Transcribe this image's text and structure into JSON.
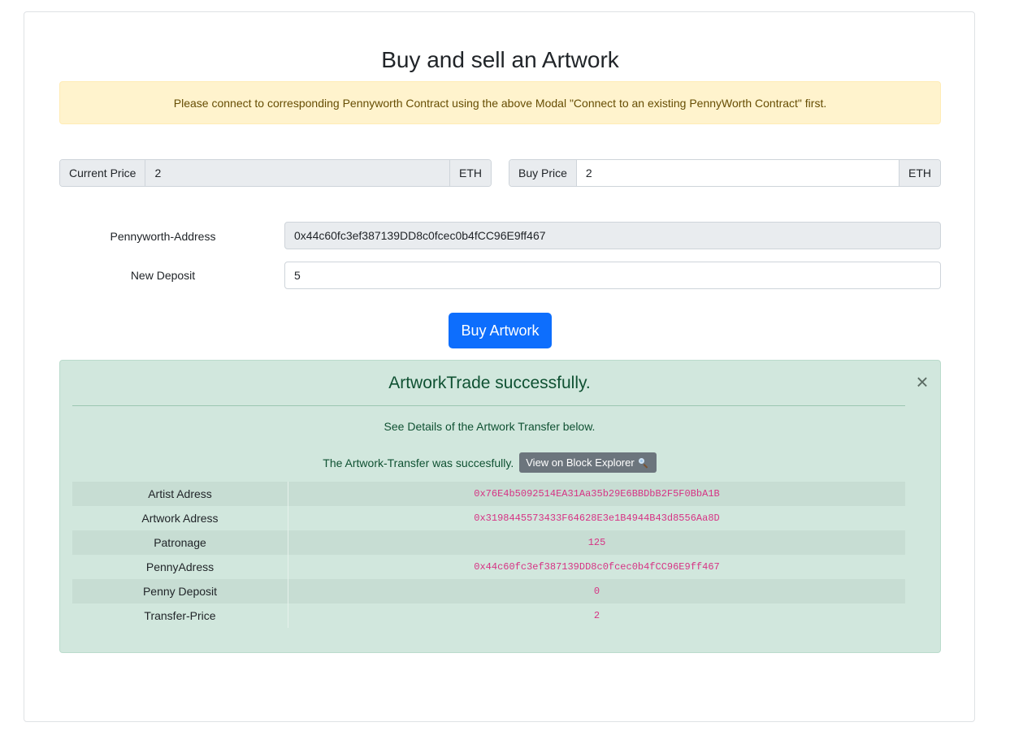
{
  "page": {
    "title": "Buy and sell an Artwork"
  },
  "warning": "Please connect to corresponding Pennyworth Contract using the above Modal \"Connect to an existing PennyWorth Contract\" first.",
  "prices": {
    "current_label": "Current Price",
    "current_value": "2",
    "current_unit": "ETH",
    "buy_label": "Buy Price",
    "buy_value": "2",
    "buy_unit": "ETH"
  },
  "form": {
    "address_label": "Pennyworth-Address",
    "address_value": "0x44c60fc3ef387139DD8c0fcec0b4fCC96E9ff467",
    "deposit_label": "New Deposit",
    "deposit_value": "5"
  },
  "buy_button": "Buy Artwork",
  "success": {
    "heading": "ArtworkTrade successfully.",
    "close_glyph": "×",
    "subtitle": "See Details of the Artwork Transfer below.",
    "transfer_text": "The Artwork-Transfer was succesfully.",
    "explorer_button": "View on Block Explorer",
    "rows": [
      {
        "key": "Artist Adress",
        "value": "0x76E4b5092514EA31Aa35b29E6BBDbB2F5F0BbA1B"
      },
      {
        "key": "Artwork Adress",
        "value": "0x3198445573433F64628E3e1B4944B43d8556Aa8D"
      },
      {
        "key": "Patronage",
        "value": "125"
      },
      {
        "key": "PennyAdress",
        "value": "0x44c60fc3ef387139DD8c0fcec0b4fCC96E9ff467"
      },
      {
        "key": "Penny Deposit",
        "value": "0"
      },
      {
        "key": "Transfer-Price",
        "value": "2"
      }
    ]
  },
  "colors": {
    "primary": "#0d6efd",
    "warning_bg": "#fff3cd",
    "success_bg": "#d1e7dd",
    "code": "#d63384",
    "secondary": "#6c757d"
  }
}
